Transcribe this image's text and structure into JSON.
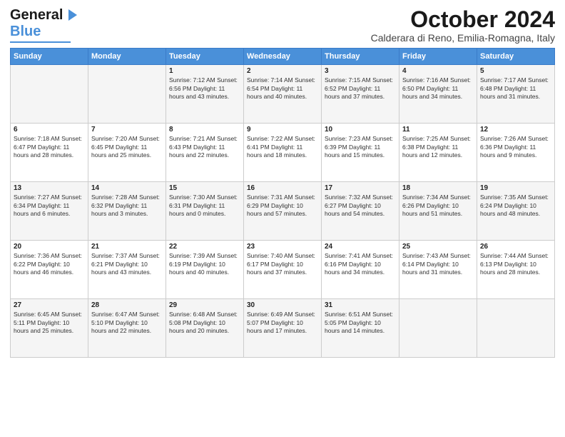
{
  "header": {
    "logo_line1": "General",
    "logo_line2": "Blue",
    "main_title": "October 2024",
    "subtitle": "Calderara di Reno, Emilia-Romagna, Italy"
  },
  "days_of_week": [
    "Sunday",
    "Monday",
    "Tuesday",
    "Wednesday",
    "Thursday",
    "Friday",
    "Saturday"
  ],
  "weeks": [
    [
      {
        "day": "",
        "info": ""
      },
      {
        "day": "",
        "info": ""
      },
      {
        "day": "1",
        "info": "Sunrise: 7:12 AM\nSunset: 6:56 PM\nDaylight: 11 hours and 43 minutes."
      },
      {
        "day": "2",
        "info": "Sunrise: 7:14 AM\nSunset: 6:54 PM\nDaylight: 11 hours and 40 minutes."
      },
      {
        "day": "3",
        "info": "Sunrise: 7:15 AM\nSunset: 6:52 PM\nDaylight: 11 hours and 37 minutes."
      },
      {
        "day": "4",
        "info": "Sunrise: 7:16 AM\nSunset: 6:50 PM\nDaylight: 11 hours and 34 minutes."
      },
      {
        "day": "5",
        "info": "Sunrise: 7:17 AM\nSunset: 6:48 PM\nDaylight: 11 hours and 31 minutes."
      }
    ],
    [
      {
        "day": "6",
        "info": "Sunrise: 7:18 AM\nSunset: 6:47 PM\nDaylight: 11 hours and 28 minutes."
      },
      {
        "day": "7",
        "info": "Sunrise: 7:20 AM\nSunset: 6:45 PM\nDaylight: 11 hours and 25 minutes."
      },
      {
        "day": "8",
        "info": "Sunrise: 7:21 AM\nSunset: 6:43 PM\nDaylight: 11 hours and 22 minutes."
      },
      {
        "day": "9",
        "info": "Sunrise: 7:22 AM\nSunset: 6:41 PM\nDaylight: 11 hours and 18 minutes."
      },
      {
        "day": "10",
        "info": "Sunrise: 7:23 AM\nSunset: 6:39 PM\nDaylight: 11 hours and 15 minutes."
      },
      {
        "day": "11",
        "info": "Sunrise: 7:25 AM\nSunset: 6:38 PM\nDaylight: 11 hours and 12 minutes."
      },
      {
        "day": "12",
        "info": "Sunrise: 7:26 AM\nSunset: 6:36 PM\nDaylight: 11 hours and 9 minutes."
      }
    ],
    [
      {
        "day": "13",
        "info": "Sunrise: 7:27 AM\nSunset: 6:34 PM\nDaylight: 11 hours and 6 minutes."
      },
      {
        "day": "14",
        "info": "Sunrise: 7:28 AM\nSunset: 6:32 PM\nDaylight: 11 hours and 3 minutes."
      },
      {
        "day": "15",
        "info": "Sunrise: 7:30 AM\nSunset: 6:31 PM\nDaylight: 11 hours and 0 minutes."
      },
      {
        "day": "16",
        "info": "Sunrise: 7:31 AM\nSunset: 6:29 PM\nDaylight: 10 hours and 57 minutes."
      },
      {
        "day": "17",
        "info": "Sunrise: 7:32 AM\nSunset: 6:27 PM\nDaylight: 10 hours and 54 minutes."
      },
      {
        "day": "18",
        "info": "Sunrise: 7:34 AM\nSunset: 6:26 PM\nDaylight: 10 hours and 51 minutes."
      },
      {
        "day": "19",
        "info": "Sunrise: 7:35 AM\nSunset: 6:24 PM\nDaylight: 10 hours and 48 minutes."
      }
    ],
    [
      {
        "day": "20",
        "info": "Sunrise: 7:36 AM\nSunset: 6:22 PM\nDaylight: 10 hours and 46 minutes."
      },
      {
        "day": "21",
        "info": "Sunrise: 7:37 AM\nSunset: 6:21 PM\nDaylight: 10 hours and 43 minutes."
      },
      {
        "day": "22",
        "info": "Sunrise: 7:39 AM\nSunset: 6:19 PM\nDaylight: 10 hours and 40 minutes."
      },
      {
        "day": "23",
        "info": "Sunrise: 7:40 AM\nSunset: 6:17 PM\nDaylight: 10 hours and 37 minutes."
      },
      {
        "day": "24",
        "info": "Sunrise: 7:41 AM\nSunset: 6:16 PM\nDaylight: 10 hours and 34 minutes."
      },
      {
        "day": "25",
        "info": "Sunrise: 7:43 AM\nSunset: 6:14 PM\nDaylight: 10 hours and 31 minutes."
      },
      {
        "day": "26",
        "info": "Sunrise: 7:44 AM\nSunset: 6:13 PM\nDaylight: 10 hours and 28 minutes."
      }
    ],
    [
      {
        "day": "27",
        "info": "Sunrise: 6:45 AM\nSunset: 5:11 PM\nDaylight: 10 hours and 25 minutes."
      },
      {
        "day": "28",
        "info": "Sunrise: 6:47 AM\nSunset: 5:10 PM\nDaylight: 10 hours and 22 minutes."
      },
      {
        "day": "29",
        "info": "Sunrise: 6:48 AM\nSunset: 5:08 PM\nDaylight: 10 hours and 20 minutes."
      },
      {
        "day": "30",
        "info": "Sunrise: 6:49 AM\nSunset: 5:07 PM\nDaylight: 10 hours and 17 minutes."
      },
      {
        "day": "31",
        "info": "Sunrise: 6:51 AM\nSunset: 5:05 PM\nDaylight: 10 hours and 14 minutes."
      },
      {
        "day": "",
        "info": ""
      },
      {
        "day": "",
        "info": ""
      }
    ]
  ]
}
